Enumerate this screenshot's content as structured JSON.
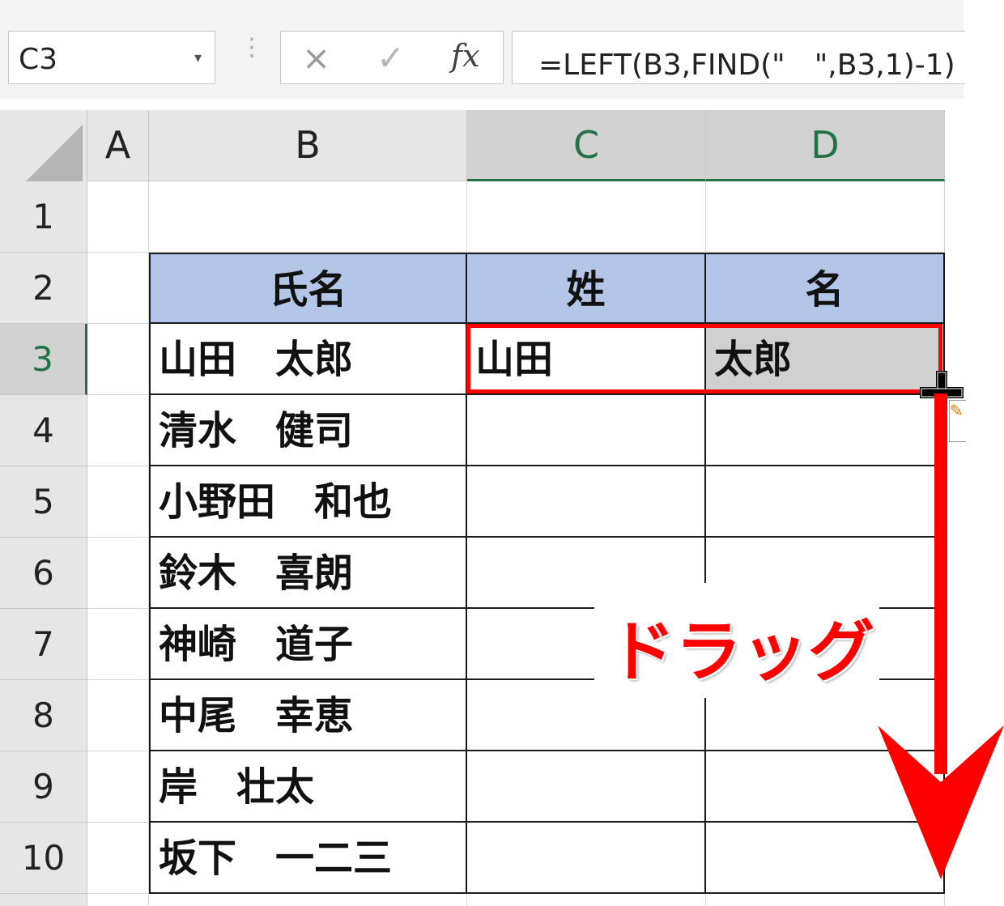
{
  "formula_bar": {
    "name_box": "C3",
    "name_box_arrow": "▾",
    "cancel_icon": "×",
    "enter_icon": "✓",
    "fx_label": "fx",
    "formula": "=LEFT(B3,FIND(\"　\",B3,1)-1)"
  },
  "columns": [
    "A",
    "B",
    "C",
    "D"
  ],
  "rows": [
    "1",
    "2",
    "3",
    "4",
    "5",
    "6",
    "7",
    "8",
    "9",
    "10"
  ],
  "table": {
    "headers": [
      "氏名",
      "姓",
      "名"
    ],
    "names": [
      "山田　太郎",
      "清水　健司",
      "小野田　和也",
      "鈴木　喜朗",
      "神崎　道子",
      "中尾　幸恵",
      "岸　壮太",
      "坂下　一二三"
    ],
    "row3": {
      "sei": "山田",
      "mei": "太郎"
    }
  },
  "annotation": {
    "label": "ドラッグ",
    "color": "#ff0000"
  },
  "colors": {
    "header_fill": "#b4c6e7",
    "selected_fill": "#d0d0d0",
    "excel_green": "#217346"
  }
}
